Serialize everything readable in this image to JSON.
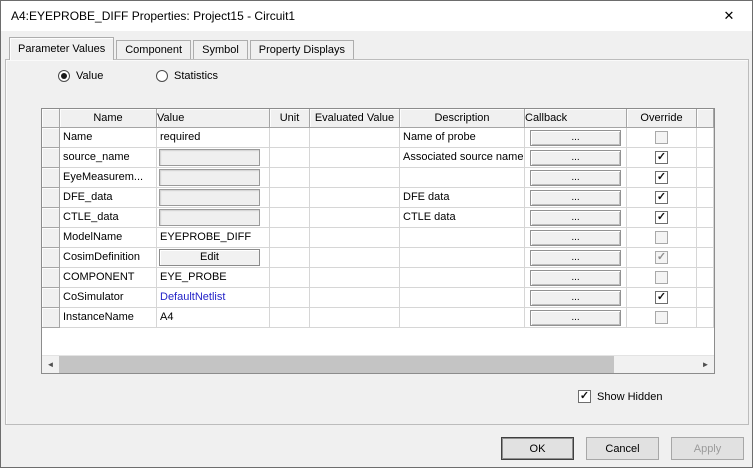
{
  "window": {
    "title": "A4:EYEPROBE_DIFF Properties: Project15 - Circuit1"
  },
  "icons": {
    "close": "✕",
    "check": "✓",
    "scroll_left": "◄",
    "scroll_right": "►"
  },
  "tabs": [
    {
      "label": "Parameter Values",
      "active": true
    },
    {
      "label": "Component",
      "active": false
    },
    {
      "label": "Symbol",
      "active": false
    },
    {
      "label": "Property Displays",
      "active": false
    }
  ],
  "radios": [
    {
      "label": "Value",
      "selected": true
    },
    {
      "label": "Statistics",
      "selected": false
    }
  ],
  "table": {
    "headers": [
      "Name",
      "Value",
      "Unit",
      "Evaluated Value",
      "Description",
      "Callback",
      "Override"
    ],
    "rows": [
      {
        "name": "Name",
        "value": "required",
        "value_kind": "text",
        "unit": "",
        "evaluated": "",
        "description": "Name of probe",
        "callback": "...",
        "override": false,
        "override_disabled": true
      },
      {
        "name": "source_name",
        "value": "",
        "value_kind": "input",
        "unit": "",
        "evaluated": "",
        "description": "Associated source name",
        "callback": "...",
        "override": true,
        "override_disabled": false
      },
      {
        "name": "EyeMeasurem...",
        "value": "",
        "value_kind": "input",
        "unit": "",
        "evaluated": "",
        "description": "",
        "callback": "...",
        "override": true,
        "override_disabled": false
      },
      {
        "name": "DFE_data",
        "value": "",
        "value_kind": "input",
        "unit": "",
        "evaluated": "",
        "description": "DFE data",
        "callback": "...",
        "override": true,
        "override_disabled": false
      },
      {
        "name": "CTLE_data",
        "value": "",
        "value_kind": "input",
        "unit": "",
        "evaluated": "",
        "description": "CTLE data",
        "callback": "...",
        "override": true,
        "override_disabled": false
      },
      {
        "name": "ModelName",
        "value": "EYEPROBE_DIFF",
        "value_kind": "text",
        "unit": "",
        "evaluated": "",
        "description": "",
        "callback": "...",
        "override": false,
        "override_disabled": true
      },
      {
        "name": "CosimDefinition",
        "value": "Edit",
        "value_kind": "button",
        "unit": "",
        "evaluated": "",
        "description": "",
        "callback": "...",
        "override": true,
        "override_disabled": true
      },
      {
        "name": "COMPONENT",
        "value": "EYE_PROBE",
        "value_kind": "text",
        "unit": "",
        "evaluated": "",
        "description": "",
        "callback": "...",
        "override": false,
        "override_disabled": true
      },
      {
        "name": "CoSimulator",
        "value": "DefaultNetlist",
        "value_kind": "link",
        "unit": "",
        "evaluated": "",
        "description": "",
        "callback": "...",
        "override": true,
        "override_disabled": false
      },
      {
        "name": "InstanceName",
        "value": "A4",
        "value_kind": "text",
        "unit": "",
        "evaluated": "",
        "description": "",
        "callback": "...",
        "override": false,
        "override_disabled": true
      }
    ]
  },
  "show_hidden": {
    "label": "Show Hidden",
    "checked": true
  },
  "buttons": {
    "ok": "OK",
    "cancel": "Cancel",
    "apply": "Apply",
    "apply_disabled": true
  },
  "colors": {
    "link_text": "#2424c8"
  }
}
